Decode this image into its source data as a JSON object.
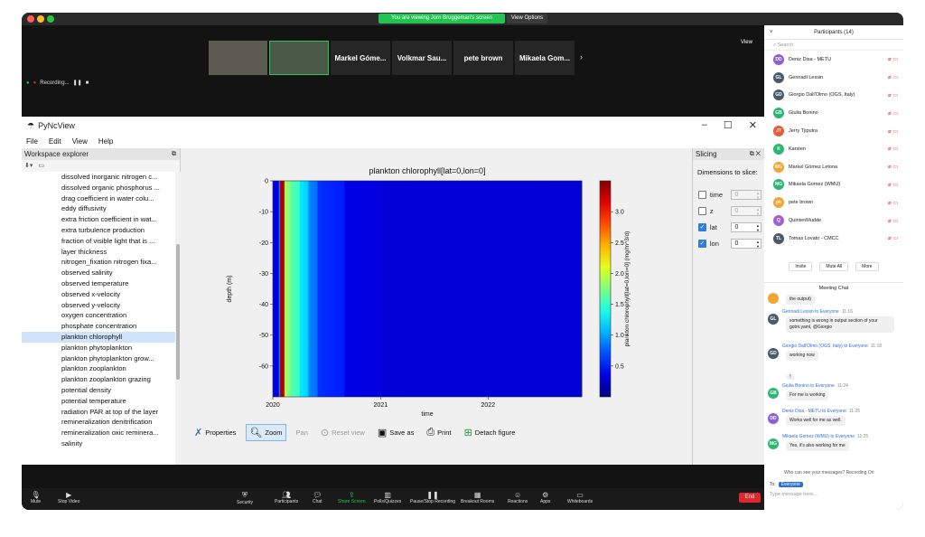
{
  "window": {
    "share_banner": "You are viewing Jorn Bruggeman's screen",
    "view_options": "View Options",
    "view_btn": "View",
    "recording": "Recording...",
    "colors": {
      "red": "#ff5f57",
      "yellow": "#febc2e",
      "green": "#28c840"
    }
  },
  "video_tiles": [
    {
      "name": ""
    },
    {
      "name": ""
    },
    {
      "name": "Markel Góme..."
    },
    {
      "name": "Volkmar Sau..."
    },
    {
      "name": "pete brown"
    },
    {
      "name": "Mikaela Gom..."
    }
  ],
  "app": {
    "title": "PyNcView",
    "menu": [
      "File",
      "Edit",
      "View",
      "Help"
    ],
    "workspace_title": "Workspace explorer",
    "workspace_items": [
      "dissolved inorganic nitrogen c...",
      "dissolved organic phosphorus ...",
      "drag coefficient in water colu...",
      "eddy diffusivity",
      "extra friction coefficient in wat...",
      "extra turbulence production",
      "fraction of visible light that is ...",
      "layer thickness",
      "nitrogen_fixation nitrogen fixa...",
      "observed salinity",
      "observed temperature",
      "observed x-velocity",
      "observed y-velocity",
      "oxygen concentration",
      "phosphate concentration",
      "plankton chlorophyll",
      "plankton phytoplankton",
      "plankton phytoplankton grow...",
      "plankton zooplankton",
      "plankton zooplankton grazing",
      "potential density",
      "potential temperature",
      "radiation PAR at top of the layer",
      "remineralization denitrification",
      "remineralization oxic reminera...",
      "salinity"
    ],
    "selected_item": "plankton chlorophyll",
    "toolbar": {
      "properties": "Properties",
      "zoom": "Zoom",
      "pan": "Pan",
      "reset": "Reset view",
      "save": "Save as",
      "print": "Print",
      "detach": "Detach figure"
    },
    "slicing": {
      "title": "Slicing",
      "dims_title": "Dimensions to slice:",
      "dims": [
        {
          "name": "time",
          "checked": false,
          "value": "0"
        },
        {
          "name": "z",
          "checked": false,
          "value": "0"
        },
        {
          "name": "lat",
          "checked": true,
          "value": "0"
        },
        {
          "name": "lon",
          "checked": true,
          "value": "0"
        }
      ]
    }
  },
  "chart_data": {
    "type": "heatmap",
    "title": "plankton chlorophyll[lat=0,lon=0]",
    "xlabel": "time",
    "ylabel": "depth (m)",
    "colorbar_label": "plankton chlorophyll[lat=0,lon=0] (mg/m^3/d)",
    "x_ticks": [
      "2020",
      "2021",
      "2022"
    ],
    "x_range": [
      "2020-01-01",
      "2022-11-15"
    ],
    "y_ticks": [
      0,
      -10,
      -20,
      -30,
      -40,
      -50,
      -60
    ],
    "ylim": [
      -70,
      0
    ],
    "colorbar_ticks": [
      0.5,
      1.0,
      1.5,
      2.0,
      2.5,
      3.0
    ],
    "clim": [
      0,
      3.5
    ],
    "colormap": "jet",
    "time_profile": [
      {
        "date": "2020-01-01",
        "value": 0.4
      },
      {
        "date": "2020-01-10",
        "value": 0.3
      },
      {
        "date": "2020-01-20",
        "value": 0.45
      },
      {
        "date": "2020-01-25",
        "value": 3.3
      },
      {
        "date": "2020-02-01",
        "value": 3.5
      },
      {
        "date": "2020-02-10",
        "value": 1.85
      },
      {
        "date": "2020-03-01",
        "value": 1.6
      },
      {
        "date": "2020-04-01",
        "value": 1.25
      },
      {
        "date": "2020-05-01",
        "value": 0.9
      },
      {
        "date": "2020-06-01",
        "value": 0.6
      },
      {
        "date": "2020-09-01",
        "value": 0.35
      },
      {
        "date": "2021-01-01",
        "value": 0.3
      },
      {
        "date": "2022-11-15",
        "value": 0.28
      }
    ]
  },
  "sidebar": {
    "participants_title": "Participants (14)",
    "search": "Search",
    "participants": [
      {
        "initials": "DD",
        "name": "Deniz Disa - METU",
        "color": "#8d5fd3"
      },
      {
        "initials": "GL",
        "name": "Gennadi Lessin",
        "color": "#4a5a6a"
      },
      {
        "initials": "GD",
        "name": "Giorgio Dall'Olmo (OGS, Italy)",
        "color": "#4a5a6a"
      },
      {
        "initials": "GB",
        "name": "Giulia Bonino",
        "color": "#2bb673"
      },
      {
        "initials": "JT",
        "name": "Jerry Tjiputra",
        "color": "#e85a3c"
      },
      {
        "initials": "K",
        "name": "Karsten",
        "color": "#2bb673"
      },
      {
        "initials": "MG",
        "name": "Markel Gómez Letona",
        "color": "#f2a533"
      },
      {
        "initials": "MG",
        "name": "Mikaela Gomez (WMU)",
        "color": "#2bb673"
      },
      {
        "initials": "pb",
        "name": "pete brown",
        "color": "#f2a533"
      },
      {
        "initials": "Q",
        "name": "QuintenMudde",
        "color": "#a45fd3"
      },
      {
        "initials": "TL",
        "name": "Tomas Lovato - CMCC",
        "color": "#4a5a6a"
      }
    ],
    "buttons": {
      "invite": "Invite",
      "mute_all": "Mute All",
      "more": "More"
    },
    "chat_title": "Meeting Chat",
    "messages": [
      {
        "initials": "",
        "from": "",
        "time": "",
        "text": "the output)",
        "color": "#f2a533",
        "top": 0
      },
      {
        "initials": "GL",
        "from": "Gennadi Lessin to Everyone",
        "time": "11:16",
        "text": "something is wrong in output section of your gotm.yaml, @Giorgio",
        "color": "#4a5a6a",
        "top": 18
      },
      {
        "initials": "GD",
        "from": "Giorgio Dall'Olmo (OGS, Italy) to Everyone",
        "time": "11:18",
        "text": "working now",
        "color": "#4a5a6a",
        "top": 56
      },
      {
        "initials": "GB",
        "from": "Giulia Bonino to Everyone",
        "time": "11:24",
        "text": "For me is working",
        "color": "#2bb673",
        "top": 100
      },
      {
        "initials": "DD",
        "from": "Deniz Disa - METU to Everyone",
        "time": "11:25",
        "text": "Works well for me as well.",
        "color": "#8d5fd3",
        "top": 128
      },
      {
        "initials": "MG",
        "from": "Mikaela Gomez (WMU) to Everyone",
        "time": "11:25",
        "text": "Yes, it's also working for me",
        "color": "#2bb673",
        "top": 156
      }
    ],
    "bang": "!",
    "note": "Who can see your messages? Recording On",
    "to_label": "To:",
    "to_value": "Everyone",
    "input_placeholder": "Type message here..."
  },
  "zoom_toolbar": [
    {
      "label": "Mute",
      "icon": "mic-icon"
    },
    {
      "label": "Stop Video",
      "icon": "camera-icon"
    },
    {
      "label": "Security",
      "icon": "shield-icon"
    },
    {
      "label": "Participants",
      "icon": "people-icon"
    },
    {
      "label": "Chat",
      "icon": "chat-icon"
    },
    {
      "label": "Share Screen",
      "icon": "share-icon"
    },
    {
      "label": "Polls/Quizzes",
      "icon": "poll-icon"
    },
    {
      "label": "Pause/Stop Recording",
      "icon": "record-icon"
    },
    {
      "label": "Breakout Rooms",
      "icon": "rooms-icon"
    },
    {
      "label": "Reactions",
      "icon": "smile-icon"
    },
    {
      "label": "Apps",
      "icon": "apps-icon"
    },
    {
      "label": "Whiteboards",
      "icon": "whiteboard-icon"
    }
  ],
  "end_label": "End"
}
